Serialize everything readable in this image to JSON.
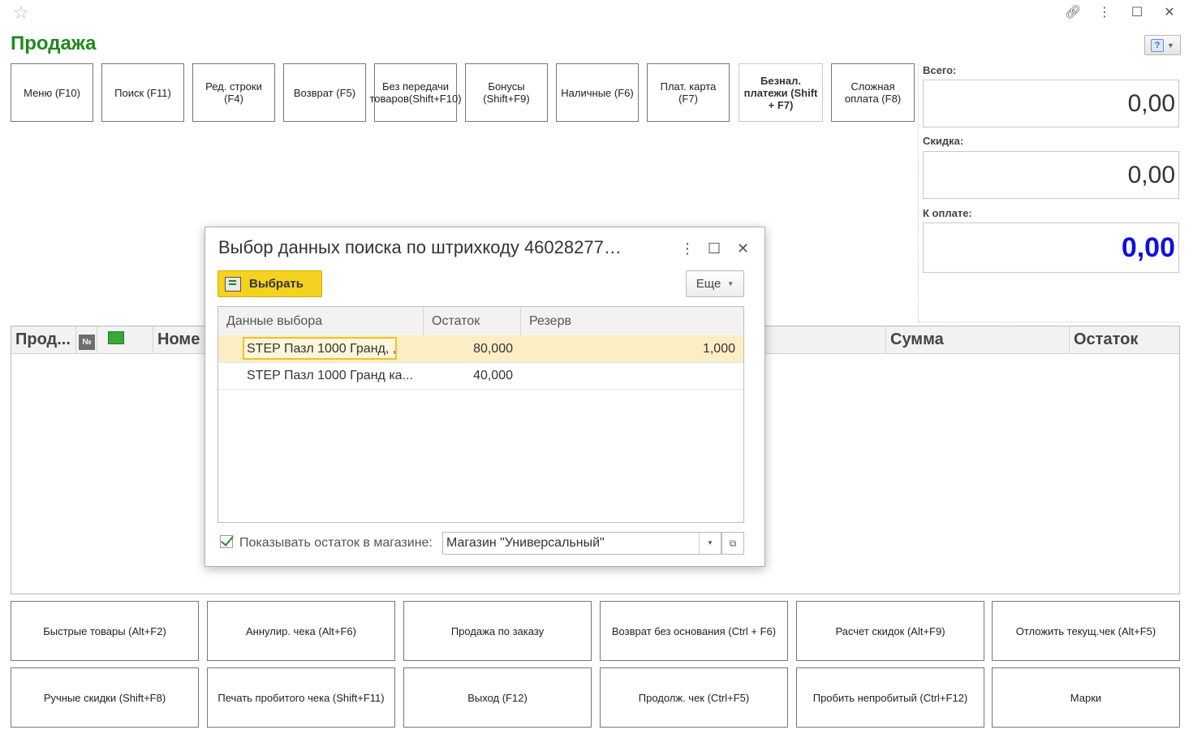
{
  "window": {
    "title": "Продажа",
    "icons": [
      "star-icon",
      "link-icon",
      "more-vertical-icon",
      "maximize-icon",
      "close-icon"
    ]
  },
  "help_button": {
    "label": "?"
  },
  "top_buttons": [
    {
      "label": "Меню (F10)",
      "disabled": false
    },
    {
      "label": "Поиск (F11)",
      "disabled": false
    },
    {
      "label": "Ред. строки (F4)",
      "disabled": false
    },
    {
      "label": "Возврат (F5)",
      "disabled": false
    },
    {
      "label": "Без передачи товаров(Shift+F10)",
      "disabled": false
    },
    {
      "label": "Бонусы (Shift+F9)",
      "disabled": false
    },
    {
      "label": "Наличные (F6)",
      "disabled": false
    },
    {
      "label": "Плат. карта (F7)",
      "disabled": false
    },
    {
      "label": "Безнал. платежи (Shift + F7)",
      "disabled": true
    },
    {
      "label": "Сложная оплата (F8)",
      "disabled": false
    }
  ],
  "totals": {
    "total_label": "Всего:",
    "total_value": "0,00",
    "discount_label": "Скидка:",
    "discount_value": "0,00",
    "to_pay_label": "К оплате:",
    "to_pay_value": "0,00",
    "to_pay_color": "#1010e0"
  },
  "main_grid": {
    "columns": [
      "Прод...",
      "№",
      "",
      "Номе",
      "Сумма",
      "Остаток"
    ]
  },
  "bottom_buttons": [
    "Быстрые товары (Alt+F2)",
    "Аннулир. чека (Alt+F6)",
    "Продажа по заказу",
    "Возврат без основания (Ctrl + F6)",
    "Расчет скидок (Alt+F9)",
    "Отложить текущ.чек (Alt+F5)",
    "Ручные скидки (Shift+F8)",
    "Печать пробитого чека (Shift+F11)",
    "Выход (F12)",
    "Продолж. чек (Ctrl+F5)",
    "Пробить непробитый (Ctrl+F12)",
    "Марки"
  ],
  "dialog": {
    "title": "Выбор данных поиска по штрихкоду 46028277…",
    "select_button": "Выбрать",
    "more_button": "Еще",
    "columns": [
      "Данные выбора",
      "Остаток",
      "Резерв"
    ],
    "rows": [
      {
        "name": "STEP Пазл 1000 Гранд, ,",
        "stock": "80,000",
        "reserve": "1,000",
        "selected": true
      },
      {
        "name": "STEP Пазл 1000 Гранд ка...",
        "stock": "40,000",
        "reserve": "",
        "selected": false
      }
    ],
    "show_stock_label": "Показывать остаток в магазине:",
    "show_stock_checked": true,
    "store_value": "Магазин \"Универсальный\""
  }
}
